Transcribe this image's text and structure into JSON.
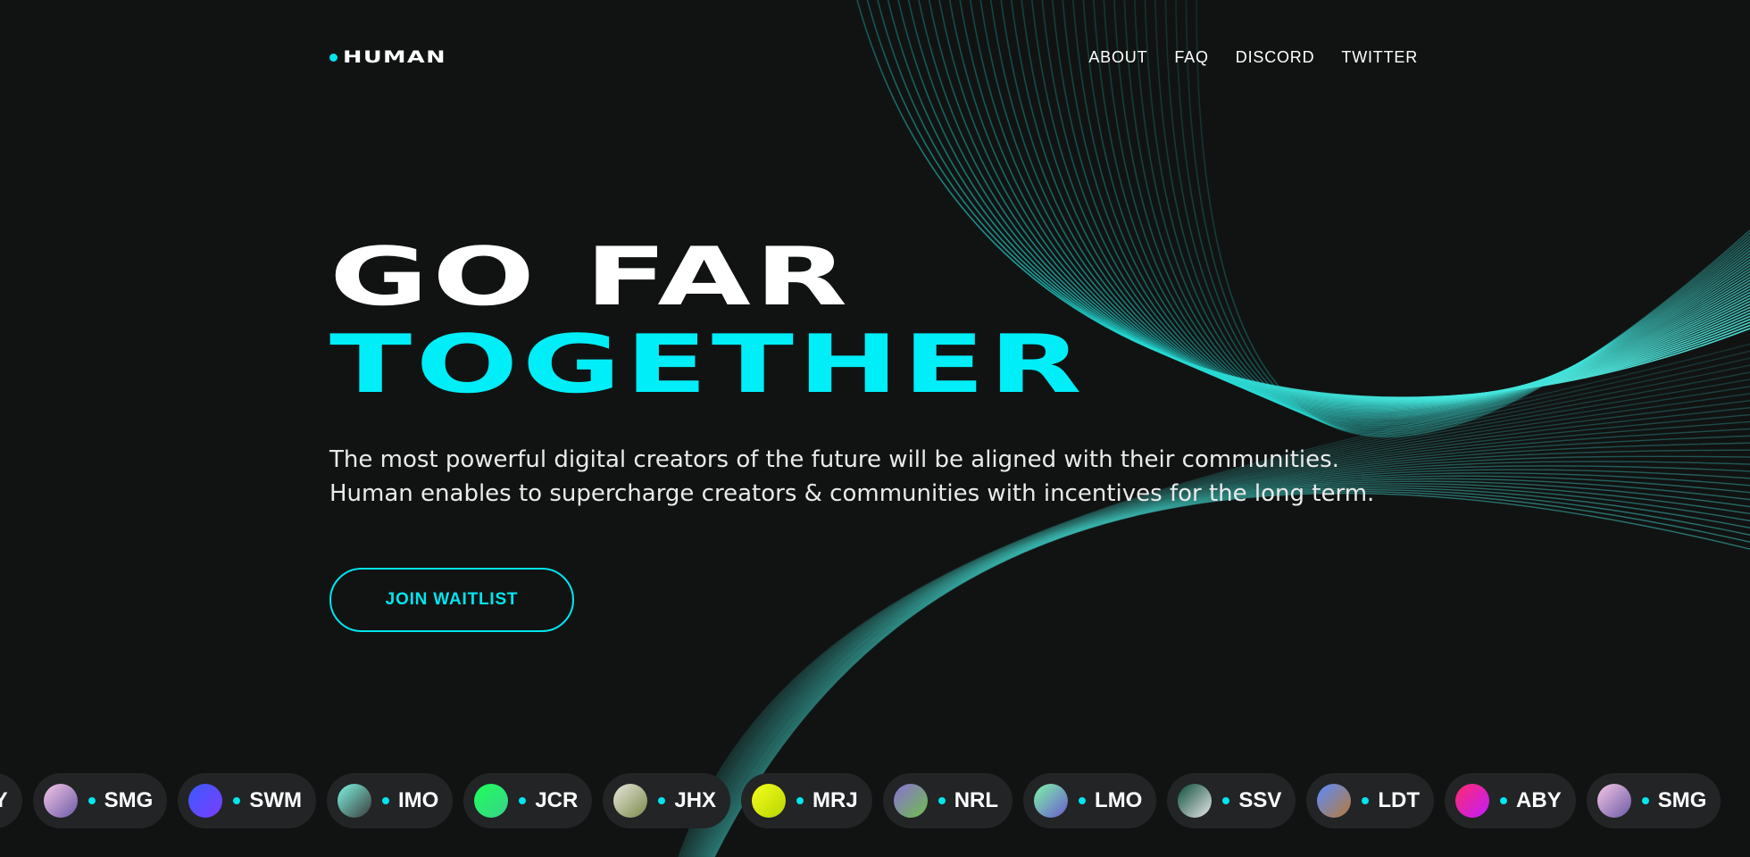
{
  "brand": {
    "name": "HUMAN",
    "accent_color": "#00e5ee"
  },
  "nav": {
    "links": [
      {
        "label": "ABOUT"
      },
      {
        "label": "FAQ"
      },
      {
        "label": "DISCORD"
      },
      {
        "label": "TWITTER"
      }
    ]
  },
  "hero": {
    "title_line1": "GO FAR",
    "title_line2": "TOGETHER",
    "subtitle_line1": "The most powerful digital creators of the future will be aligned with their communities.",
    "subtitle_line2": "Human enables to supercharge creators & communities with incentives for the long term.",
    "cta_label": "JOIN WAITLIST"
  },
  "ticker": {
    "items": [
      {
        "label": "ABY",
        "avatar": "pink-gradient-avatar",
        "color1": "#ff2a6d",
        "color2": "#c21dff"
      },
      {
        "label": "SMG",
        "avatar": "pixel-robot-avatar",
        "color1": "#f5c6e6",
        "color2": "#6b5aa6"
      },
      {
        "label": "SWM",
        "avatar": "blue-gradient-avatar",
        "color1": "#3a5bff",
        "color2": "#7b3cff"
      },
      {
        "label": "IMO",
        "avatar": "pixel-character-avatar",
        "color1": "#7ff5e3",
        "color2": "#3a3a3a"
      },
      {
        "label": "JCR",
        "avatar": "green-gradient-avatar",
        "color1": "#1eff5a",
        "color2": "#3ad18a"
      },
      {
        "label": "JHX",
        "avatar": "portrait-avatar",
        "color1": "#e8e6dc",
        "color2": "#7a8a4a"
      },
      {
        "label": "MRJ",
        "avatar": "yellow-gradient-avatar",
        "color1": "#f5ff1e",
        "color2": "#b8d400"
      },
      {
        "label": "NRL",
        "avatar": "frog-avatar",
        "color1": "#8b6fd6",
        "color2": "#6fbf4a"
      },
      {
        "label": "LMO",
        "avatar": "alien-avatar",
        "color1": "#7ff5a8",
        "color2": "#6a5acd"
      },
      {
        "label": "SSV",
        "avatar": "masked-avatar",
        "color1": "#0d4d3a",
        "color2": "#e8e8e8"
      },
      {
        "label": "LDT",
        "avatar": "hat-character-avatar",
        "color1": "#5a8cff",
        "color2": "#b87a3a"
      },
      {
        "label": "ABY",
        "avatar": "pink-gradient-avatar",
        "color1": "#ff2a6d",
        "color2": "#c21dff"
      },
      {
        "label": "SMG",
        "avatar": "pixel-robot-avatar",
        "color1": "#f5c6e6",
        "color2": "#6b5aa6"
      }
    ]
  }
}
